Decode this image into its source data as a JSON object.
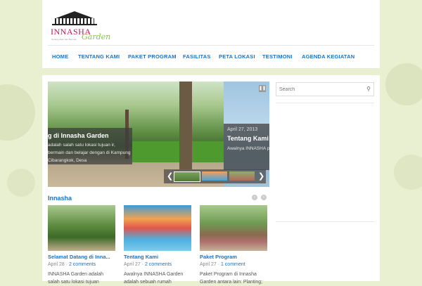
{
  "logo": {
    "name": "INNASHA",
    "script": "Garden",
    "tagline": "Tentang Alam dan Bermain"
  },
  "nav": {
    "items": [
      {
        "label": "HOME"
      },
      {
        "label": "TENTANG KAMI"
      },
      {
        "label": "PAKET PROGRAM"
      },
      {
        "label": "FASILITAS"
      },
      {
        "label": "PETA LOKASI"
      },
      {
        "label": "TESTIMONI"
      },
      {
        "label": "AGENDA KEGIATAN"
      }
    ]
  },
  "slider": {
    "main": {
      "title": "g di Innasha Garden",
      "excerpt": "adalah salah satu lokasi tujuan ir, bermain dan belajar dengan di Kampung Cibarangkok, Desa"
    },
    "next": {
      "date": "April 27, 2013",
      "title": "Tentang Kami",
      "excerpt": "Awalnya INNASHA peristirahatan di P Senior Crown Amb"
    },
    "pause_icon": "pause-icon",
    "prev_icon": "chevron-left-icon",
    "next_icon": "chevron-right-icon"
  },
  "section": {
    "title": "Innasha"
  },
  "cards": [
    {
      "title": "Selamat Datang di Inna...",
      "date": "April 28",
      "comments": "2 comments",
      "excerpt": "INNASHA Garden adalah salah satu lokasi tujuan"
    },
    {
      "title": "Tentang Kami",
      "date": "April 27",
      "comments": "2 comments",
      "excerpt": "Awalnya INNASHA Garden adalah sebuah rumah"
    },
    {
      "title": "Paket Program",
      "date": "April 27",
      "comments": "1 comment",
      "excerpt": "Paket Program di Innasha Garden antara lain: Planting;"
    }
  ],
  "sidebar": {
    "search_placeholder": "Search",
    "search_icon": "search-icon"
  },
  "colors": {
    "link": "#1e73be",
    "background": "#e9f0d2"
  }
}
